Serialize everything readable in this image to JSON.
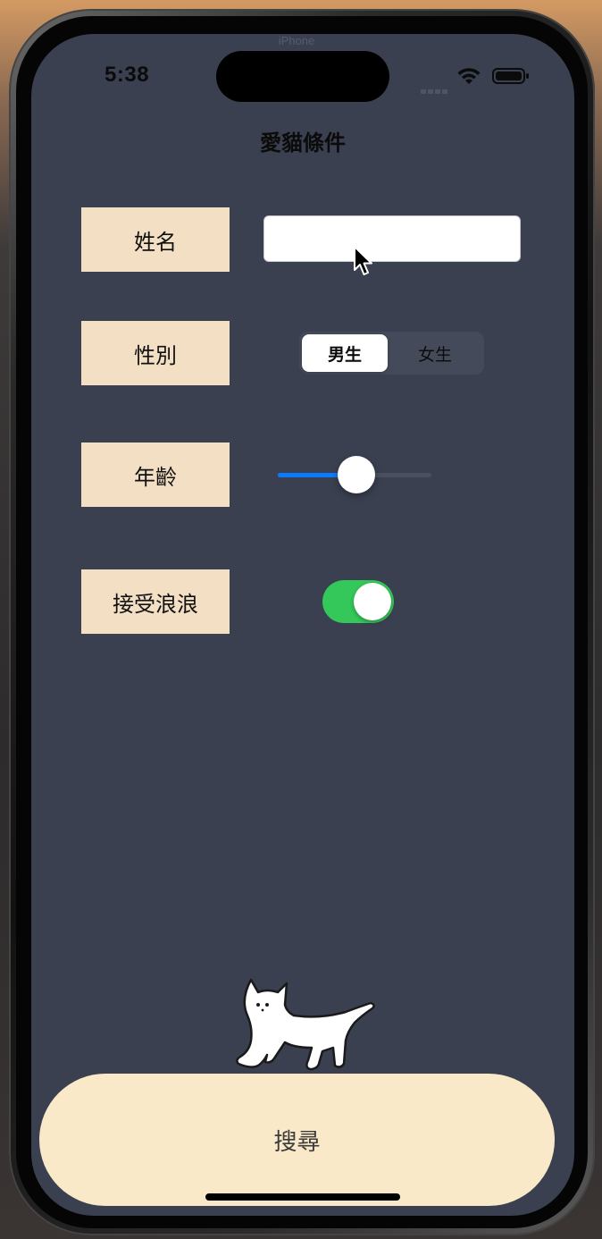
{
  "status_bar": {
    "time": "5:38",
    "island_text": "iPhone"
  },
  "form": {
    "title": "愛貓條件",
    "name": {
      "label": "姓名",
      "value": "",
      "placeholder": ""
    },
    "gender": {
      "label": "性別",
      "options": [
        "男生",
        "女生"
      ],
      "selected": "男生"
    },
    "age": {
      "label": "年齡",
      "slider_fraction": 0.51
    },
    "stray": {
      "label": "接受浪浪",
      "toggle_on": true
    }
  },
  "search_button": {
    "label": "搜尋"
  },
  "colors": {
    "screen_background": "#3a4050",
    "label_background": "#f2dfc4",
    "slider_accent": "#0a7bff",
    "toggle_on": "#34c759",
    "search_button": "#f9e9c9"
  },
  "icons": {
    "wifi": "wifi-icon",
    "battery": "battery-icon",
    "cursor": "mouse-pointer-icon",
    "cat": "cat-illustration"
  }
}
